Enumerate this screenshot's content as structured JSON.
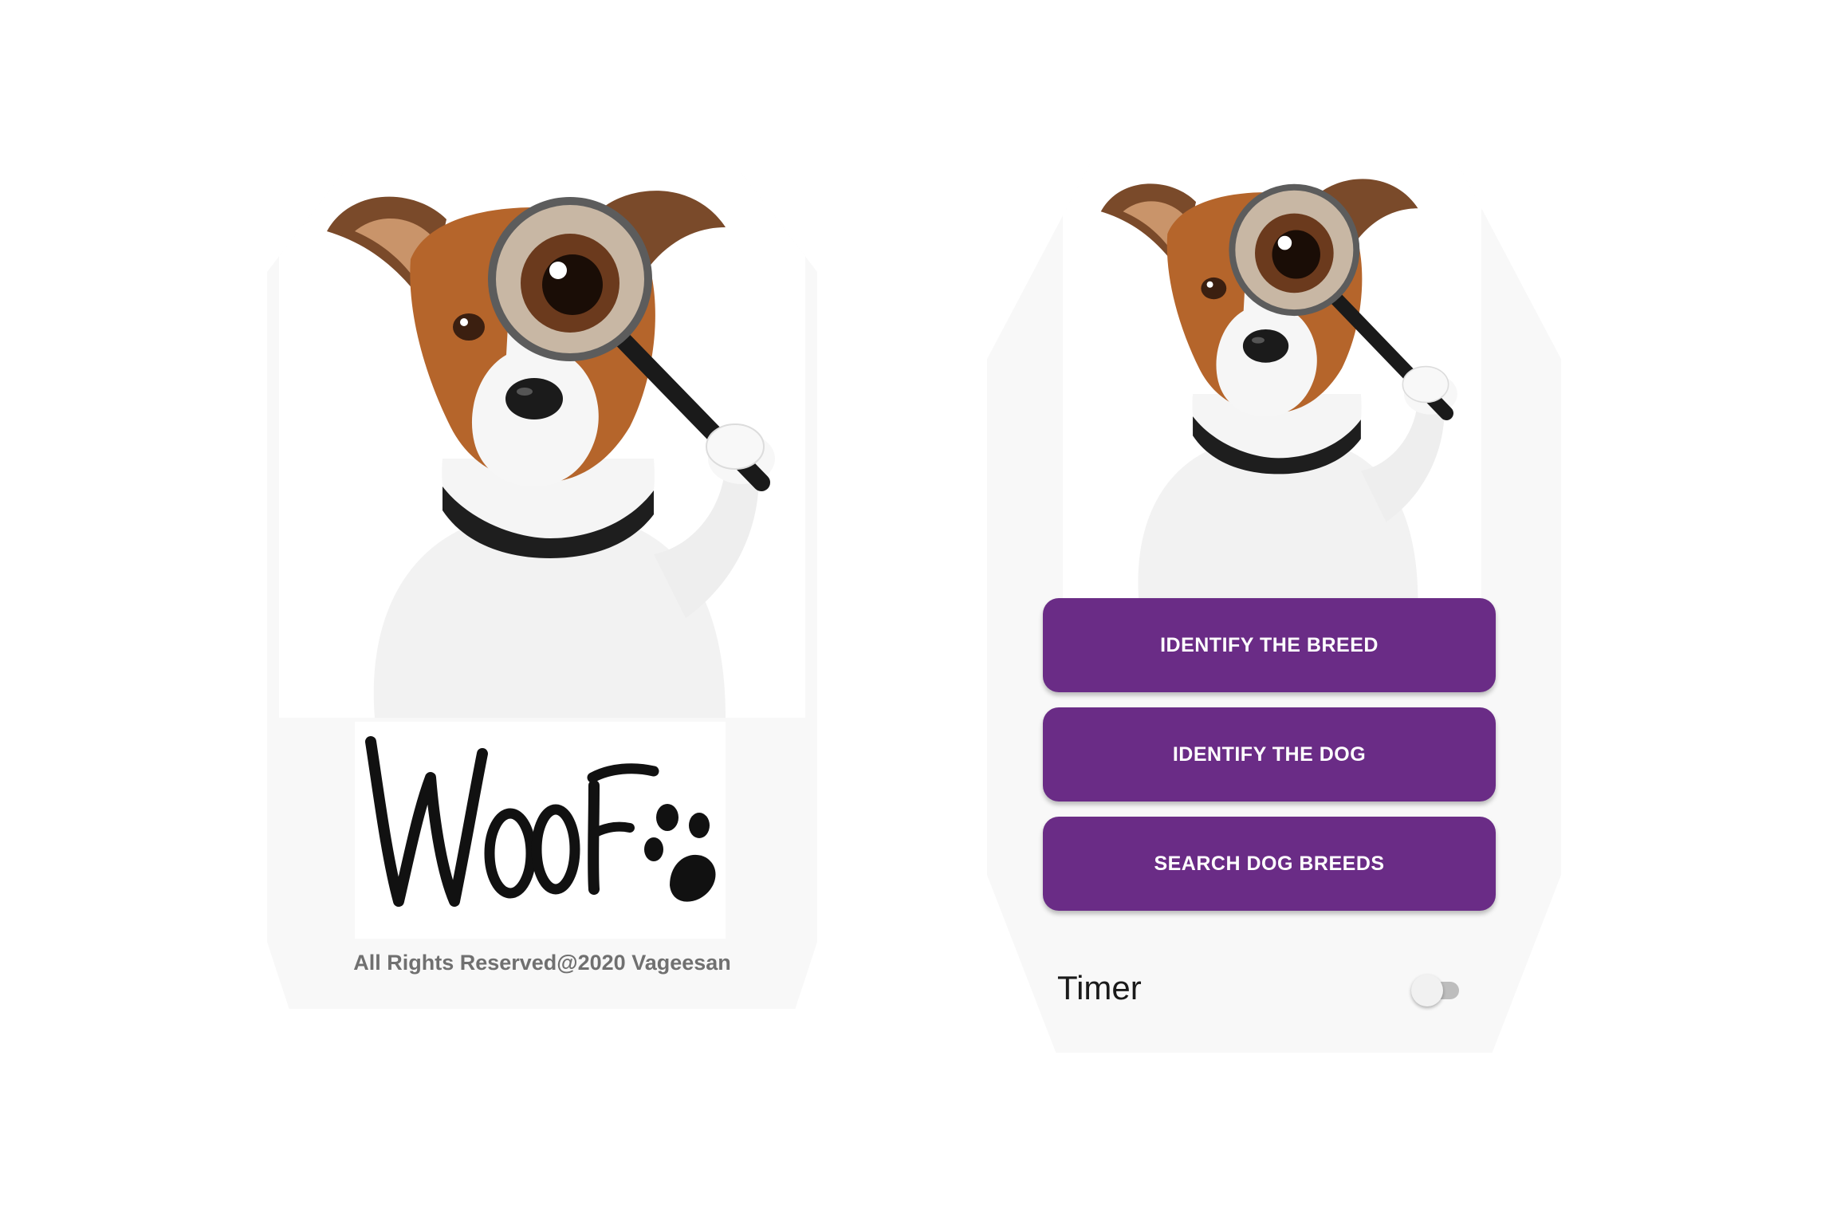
{
  "splash_screen": {
    "logo_text": "WooF",
    "copyright": "All Rights Reserved@2020 Vageesan"
  },
  "home_screen": {
    "buttons": [
      {
        "label": "IDENTIFY THE BREED"
      },
      {
        "label": "IDENTIFY THE DOG"
      },
      {
        "label": "SEARCH DOG BREEDS"
      }
    ],
    "timer": {
      "label": "Timer",
      "enabled": false
    }
  },
  "colors": {
    "accent": "#6a2c86",
    "screen_background": "#f8f8f8",
    "copyright_text": "#707070"
  },
  "icons": [
    "paw-icon",
    "magnifying-glass"
  ]
}
